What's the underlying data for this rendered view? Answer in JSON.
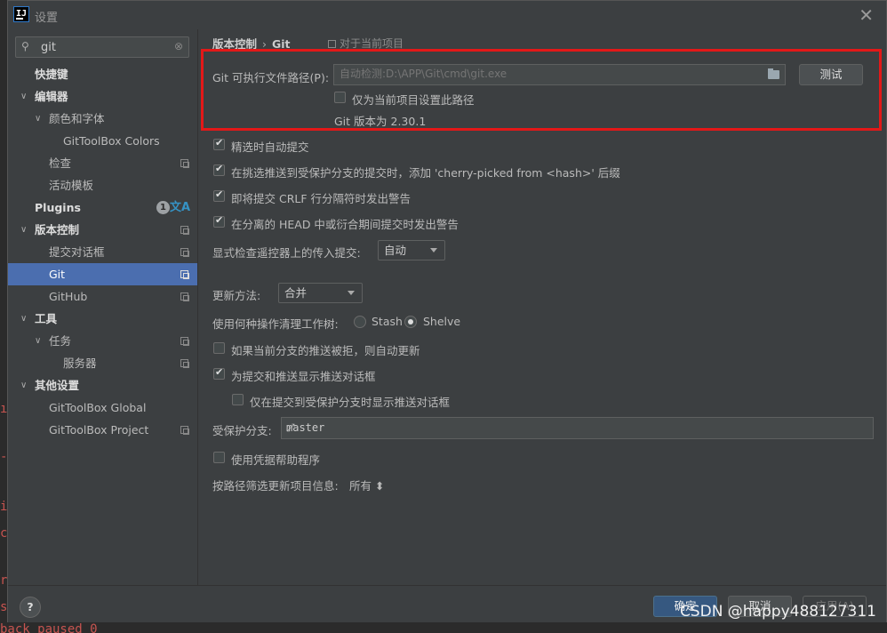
{
  "window": {
    "title": "设置",
    "app_icon_text": "IJ"
  },
  "background_code": [
    "ı",
    "-c",
    "it",
    "co",
    "r-c",
    "s",
    "back paused 0"
  ],
  "search": {
    "value": "git"
  },
  "sidebar": {
    "items": [
      {
        "label": "快捷键",
        "level": 0,
        "bold": true,
        "arrow": ""
      },
      {
        "label": "编辑器",
        "level": 0,
        "bold": true,
        "arrow": "∨"
      },
      {
        "label": "颜色和字体",
        "level": 1,
        "bold": false,
        "arrow": "∨"
      },
      {
        "label": "GitToolBox Colors",
        "level": 2,
        "bold": false,
        "arrow": ""
      },
      {
        "label": "检查",
        "level": 1,
        "bold": false,
        "arrow": "",
        "copy": true
      },
      {
        "label": "活动模板",
        "level": 1,
        "bold": false,
        "arrow": ""
      },
      {
        "label": "Plugins",
        "level": 0,
        "bold": true,
        "arrow": "",
        "badge": "1",
        "translate": "文A"
      },
      {
        "label": "版本控制",
        "level": 0,
        "bold": true,
        "arrow": "∨",
        "copy": true
      },
      {
        "label": "提交对话框",
        "level": 1,
        "bold": false,
        "arrow": "",
        "copy": true
      },
      {
        "label": "Git",
        "level": 1,
        "bold": false,
        "arrow": "",
        "copy": true,
        "selected": true
      },
      {
        "label": "GitHub",
        "level": 1,
        "bold": false,
        "arrow": "",
        "copy": true
      },
      {
        "label": "工具",
        "level": 0,
        "bold": true,
        "arrow": "∨"
      },
      {
        "label": "任务",
        "level": 1,
        "bold": false,
        "arrow": "∨",
        "copy": true
      },
      {
        "label": "服务器",
        "level": 2,
        "bold": false,
        "arrow": "",
        "copy": true
      },
      {
        "label": "其他设置",
        "level": 0,
        "bold": true,
        "arrow": "∨"
      },
      {
        "label": "GitToolBox Global",
        "level": 1,
        "bold": false,
        "arrow": ""
      },
      {
        "label": "GitToolBox Project",
        "level": 1,
        "bold": false,
        "arrow": "",
        "copy": true
      }
    ]
  },
  "breadcrumb": {
    "parent": "版本控制",
    "separator": "›",
    "current": "Git",
    "scope": "对于当前项目"
  },
  "git_path": {
    "label": "Git 可执行文件路径(P):",
    "placeholder": "自动检测:D:\\APP\\Git\\cmd\\git.exe",
    "test_button": "测试",
    "project_only_label": "仅为当前项目设置此路径",
    "project_only_checked": false,
    "version_text": "Git 版本为 2.30.1"
  },
  "options": {
    "auto_commit_label": "精选时自动提交",
    "auto_commit": true,
    "cherry_pick_label": "在挑选推送到受保护分支的提交时，添加 'cherry-picked from <hash>' 后缀",
    "cherry_pick": true,
    "crlf_label": "即将提交 CRLF 行分隔符时发出警告",
    "crlf": true,
    "detached_head_label": "在分离的 HEAD 中或衍合期间提交时发出警告",
    "detached_head": true,
    "incoming_label": "显式检查遥控器上的传入提交:",
    "incoming_value": "自动",
    "update_method_label": "更新方法:",
    "update_method_value": "合并",
    "clean_tree_label": "使用何种操作清理工作树:",
    "stash_label": "Stash",
    "shelve_label": "Shelve",
    "clean_tree_selected": "Shelve",
    "auto_update_label": "如果当前分支的推送被拒，则自动更新",
    "auto_update": false,
    "push_dialog_label": "为提交和推送显示推送对话框",
    "push_dialog": true,
    "push_dialog_protected_label": "仅在提交到受保护分支时显示推送对话框",
    "push_dialog_protected": false,
    "protected_branches_label": "受保护分支:",
    "protected_branches_value": "master",
    "credential_helper_label": "使用凭据帮助程序",
    "credential_helper": false,
    "filter_label": "按路径筛选更新项目信息:",
    "filter_value": "所有 ⬍"
  },
  "footer": {
    "help": "?",
    "ok": "确定",
    "cancel": "取消",
    "apply": "应用(A)"
  },
  "watermark": "CSDN @happy488127311",
  "colors": {
    "selected": "#4b6eaf",
    "highlight_border": "#e31818",
    "ok_button": "#365880"
  }
}
